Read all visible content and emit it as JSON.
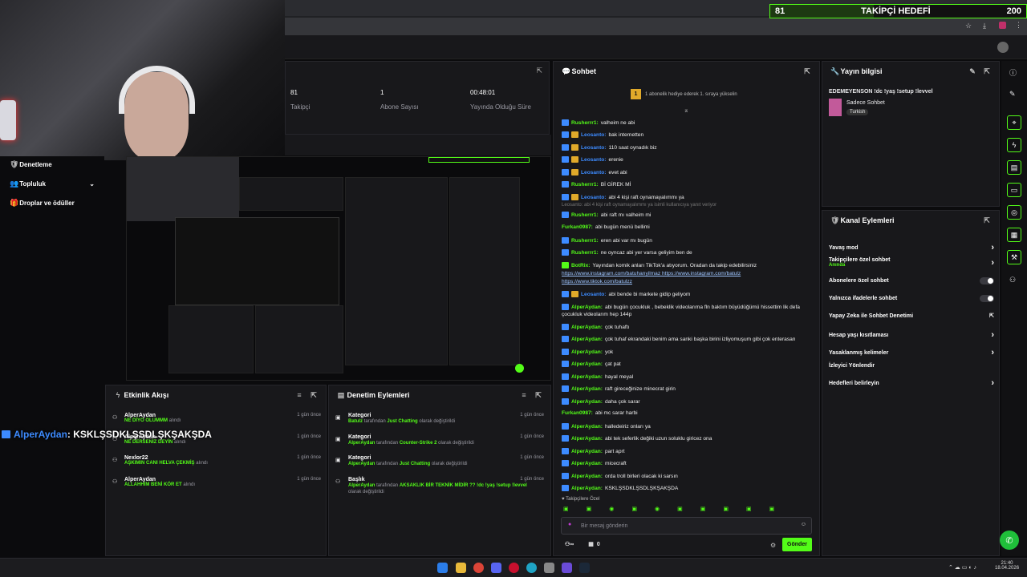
{
  "goal": {
    "current": "81",
    "label": "TAKİPÇİ HEDEFİ",
    "target": "200",
    "progress": 0.405
  },
  "stats": [
    {
      "value": "81",
      "label": "Takipçi"
    },
    {
      "value": "1",
      "label": "Abone Sayısı"
    },
    {
      "value": "00:48:01",
      "label": "Yayında Olduğu Süre"
    }
  ],
  "nav": {
    "moderation": "Denetleme",
    "community": "Topluluk",
    "drops": "Droplar ve ödüller"
  },
  "chat": {
    "title": "Sohbet",
    "pinned": "1 abonelik hediye ederek 1. sıraya yükselin",
    "reply_note": "Leosanto: abi 4 kişi raft oynamayalımmı ya isimli kullanıcıya yanıt veriyor",
    "messages": [
      {
        "user": "Rusherrr1",
        "text": "valheim ne abi",
        "kind": "green-badge"
      },
      {
        "user": "Leosanto",
        "text": "bak internetten",
        "kind": "blue-crown"
      },
      {
        "user": "Leosanto",
        "text": "110 saat oynadık biz",
        "kind": "blue-crown"
      },
      {
        "user": "Leosanto",
        "text": "erenie",
        "kind": "blue-crown"
      },
      {
        "user": "Leosanto",
        "text": "evet abi",
        "kind": "blue-crown"
      },
      {
        "user": "Rusherrr1",
        "text": "Bİ GİREK Mİ",
        "kind": "green-badge"
      },
      {
        "user": "Leosanto",
        "text": "abi 4 kişi raft oynamayalımmı ya",
        "kind": "blue-crown"
      },
      {
        "user": "Rusherrr1",
        "text": "abi raft mı valheim mi",
        "kind": "green-badge"
      },
      {
        "user": "Furkan0987",
        "text": "abi bugün menü bellimi",
        "kind": "green"
      },
      {
        "user": "Rusherrr1",
        "text": "eren abi var mı bugün",
        "kind": "green-badge"
      },
      {
        "user": "Rusherrr1",
        "text": "ne oyncaz abi yer varsa geliyim ben de",
        "kind": "green-badge"
      },
      {
        "user": "BotRix",
        "text": "Yayından komik anları TikTok'a atıyorum. Oradan da takip edebilirsiniz",
        "kind": "bot"
      },
      {
        "user": "",
        "text": "https://www.instagram.com/batuhanyilmaz https://www.instagram.com/batulz",
        "kind": "link"
      },
      {
        "user": "",
        "text": "https://www.tiktok.com/batulzz",
        "kind": "link"
      },
      {
        "user": "Leosanto",
        "text": "abi bende bi markete gidip geliyom",
        "kind": "blue-crown"
      },
      {
        "user": "AlperAydan",
        "text": "abi bugün çocukluk , bebeklik videolarıma fln baktım büyüdüğümü hissettim lik defa",
        "kind": "green-badge"
      },
      {
        "user": "",
        "text": "çocukluk videolarım hep 144p",
        "kind": "plain"
      },
      {
        "user": "AlperAydan",
        "text": "çok tuhaftı",
        "kind": "green-badge"
      },
      {
        "user": "AlperAydan",
        "text": "çok tuhaf ekrandaki benim ama sanki başka birini izliyomuşum gibi çok enterasan",
        "kind": "green-badge"
      },
      {
        "user": "AlperAydan",
        "text": "yok",
        "kind": "green-badge"
      },
      {
        "user": "AlperAydan",
        "text": "çat pat",
        "kind": "green-badge"
      },
      {
        "user": "AlperAydan",
        "text": "hayal meyal",
        "kind": "green-badge"
      },
      {
        "user": "AlperAydan",
        "text": "raft gireceğinize minecrat girin",
        "kind": "green-badge"
      },
      {
        "user": "AlperAydan",
        "text": "daha çok sarar",
        "kind": "green-badge"
      },
      {
        "user": "Furkan0987",
        "text": "abi mc sarar harbi",
        "kind": "green"
      },
      {
        "user": "AlperAydan",
        "text": "halledeiriz onları ya",
        "kind": "green-badge"
      },
      {
        "user": "AlperAydan",
        "text": "abi tek seferlik değiki uzun soluklu giricez ona",
        "kind": "green-badge"
      },
      {
        "user": "AlperAydan",
        "text": "part aprt",
        "kind": "green-badge"
      },
      {
        "user": "AlperAydan",
        "text": "micecraft",
        "kind": "green-badge"
      },
      {
        "user": "AlperAydan",
        "text": "orda troll birleri olacak ki sarsın",
        "kind": "green-badge"
      },
      {
        "user": "AlperAydan",
        "text": "KSKLŞSDKLŞSDLŞKŞAKŞDA",
        "kind": "green-badge"
      }
    ],
    "followers_only": "Takipçilere Özel",
    "input_placeholder": "Bir mesaj gönderin",
    "send": "Gönder",
    "viewer_count": "0"
  },
  "overlay_msg": {
    "user": "AlperAydan",
    "text": ": KSKLŞSDKLŞSDLŞKŞAKŞDA"
  },
  "stream_info": {
    "title": "Yayın bilgisi",
    "stream_title": "EDEMEYENSON !dc !yaş !setup !levvel",
    "category": "Sadece Sohbet",
    "tag": "Turkish"
  },
  "channel_actions": {
    "title": "Kanal Eylemleri",
    "items": [
      {
        "label": "Yavaş mod",
        "type": "arrow"
      },
      {
        "label": "Takipçilere özel sohbet",
        "sub": "Anında",
        "type": "arrow"
      },
      {
        "label": "Abonelere özel sohbet",
        "type": "toggle"
      },
      {
        "label": "Yalnızca ifadelerle sohbet",
        "type": "toggle"
      },
      {
        "label": "Yapay Zeka ile Sohbet Denetimi",
        "type": "external"
      },
      {
        "label": "Hesap yaşı kısıtlaması",
        "type": "arrow"
      },
      {
        "label": "Yasaklanmış kelimeler",
        "type": "arrow"
      },
      {
        "label": "İzleyici Yönlendir",
        "type": "none"
      },
      {
        "label": "Hedefleri belirleyin",
        "type": "arrow"
      }
    ]
  },
  "activity": {
    "title": "Etkinlik Akışı",
    "items": [
      {
        "user": "AlperAydan",
        "text": "NE DİYO OLUMMM",
        "suffix": "alındı",
        "time": "1 gün önce"
      },
      {
        "user": "AlperAydan",
        "text": "NE DERSENİZ DEYİN",
        "suffix": "alındı",
        "time": "1 gün önce"
      },
      {
        "user": "Nexlor22",
        "text": "AŞKIMIN CANI HELVA ÇEKMİŞ",
        "suffix": "alındı",
        "time": "1 gün önce"
      },
      {
        "user": "AlperAydan",
        "text": "ALLAHHIM BENİ KÖR ET",
        "suffix": "alındı",
        "time": "1 gün önce"
      }
    ]
  },
  "modlog": {
    "title": "Denetim Eylemleri",
    "items": [
      {
        "type": "Kategori",
        "actor": "Batulz",
        "mid": "tarafından",
        "value": "Just Chatting",
        "end": "olarak değiştirildi",
        "time": "1 gün önce"
      },
      {
        "type": "Kategori",
        "actor": "AlperAydan",
        "mid": "tarafından",
        "value": "Counter-Strike 2",
        "end": "olarak değiştirildi",
        "time": "1 gün önce"
      },
      {
        "type": "Kategori",
        "actor": "AlperAydan",
        "mid": "tarafından",
        "value": "Just Chatting",
        "end": "olarak değiştirildi",
        "time": "1 gün önce"
      },
      {
        "type": "Başlık",
        "actor": "AlperAydan",
        "mid": "tarafından",
        "value": "AKSAKLIK BİR TEKNİK MİDİR ?? !dc !yaş !setup !levvel",
        "end": "olarak değiştirildi",
        "time": "1 gün önce"
      }
    ]
  },
  "taskbar": {
    "time": "21:40",
    "date": "18.04.2026"
  },
  "colors": {
    "accent": "#53fc18",
    "bg": "#18181b",
    "link": "#3d8bff"
  }
}
